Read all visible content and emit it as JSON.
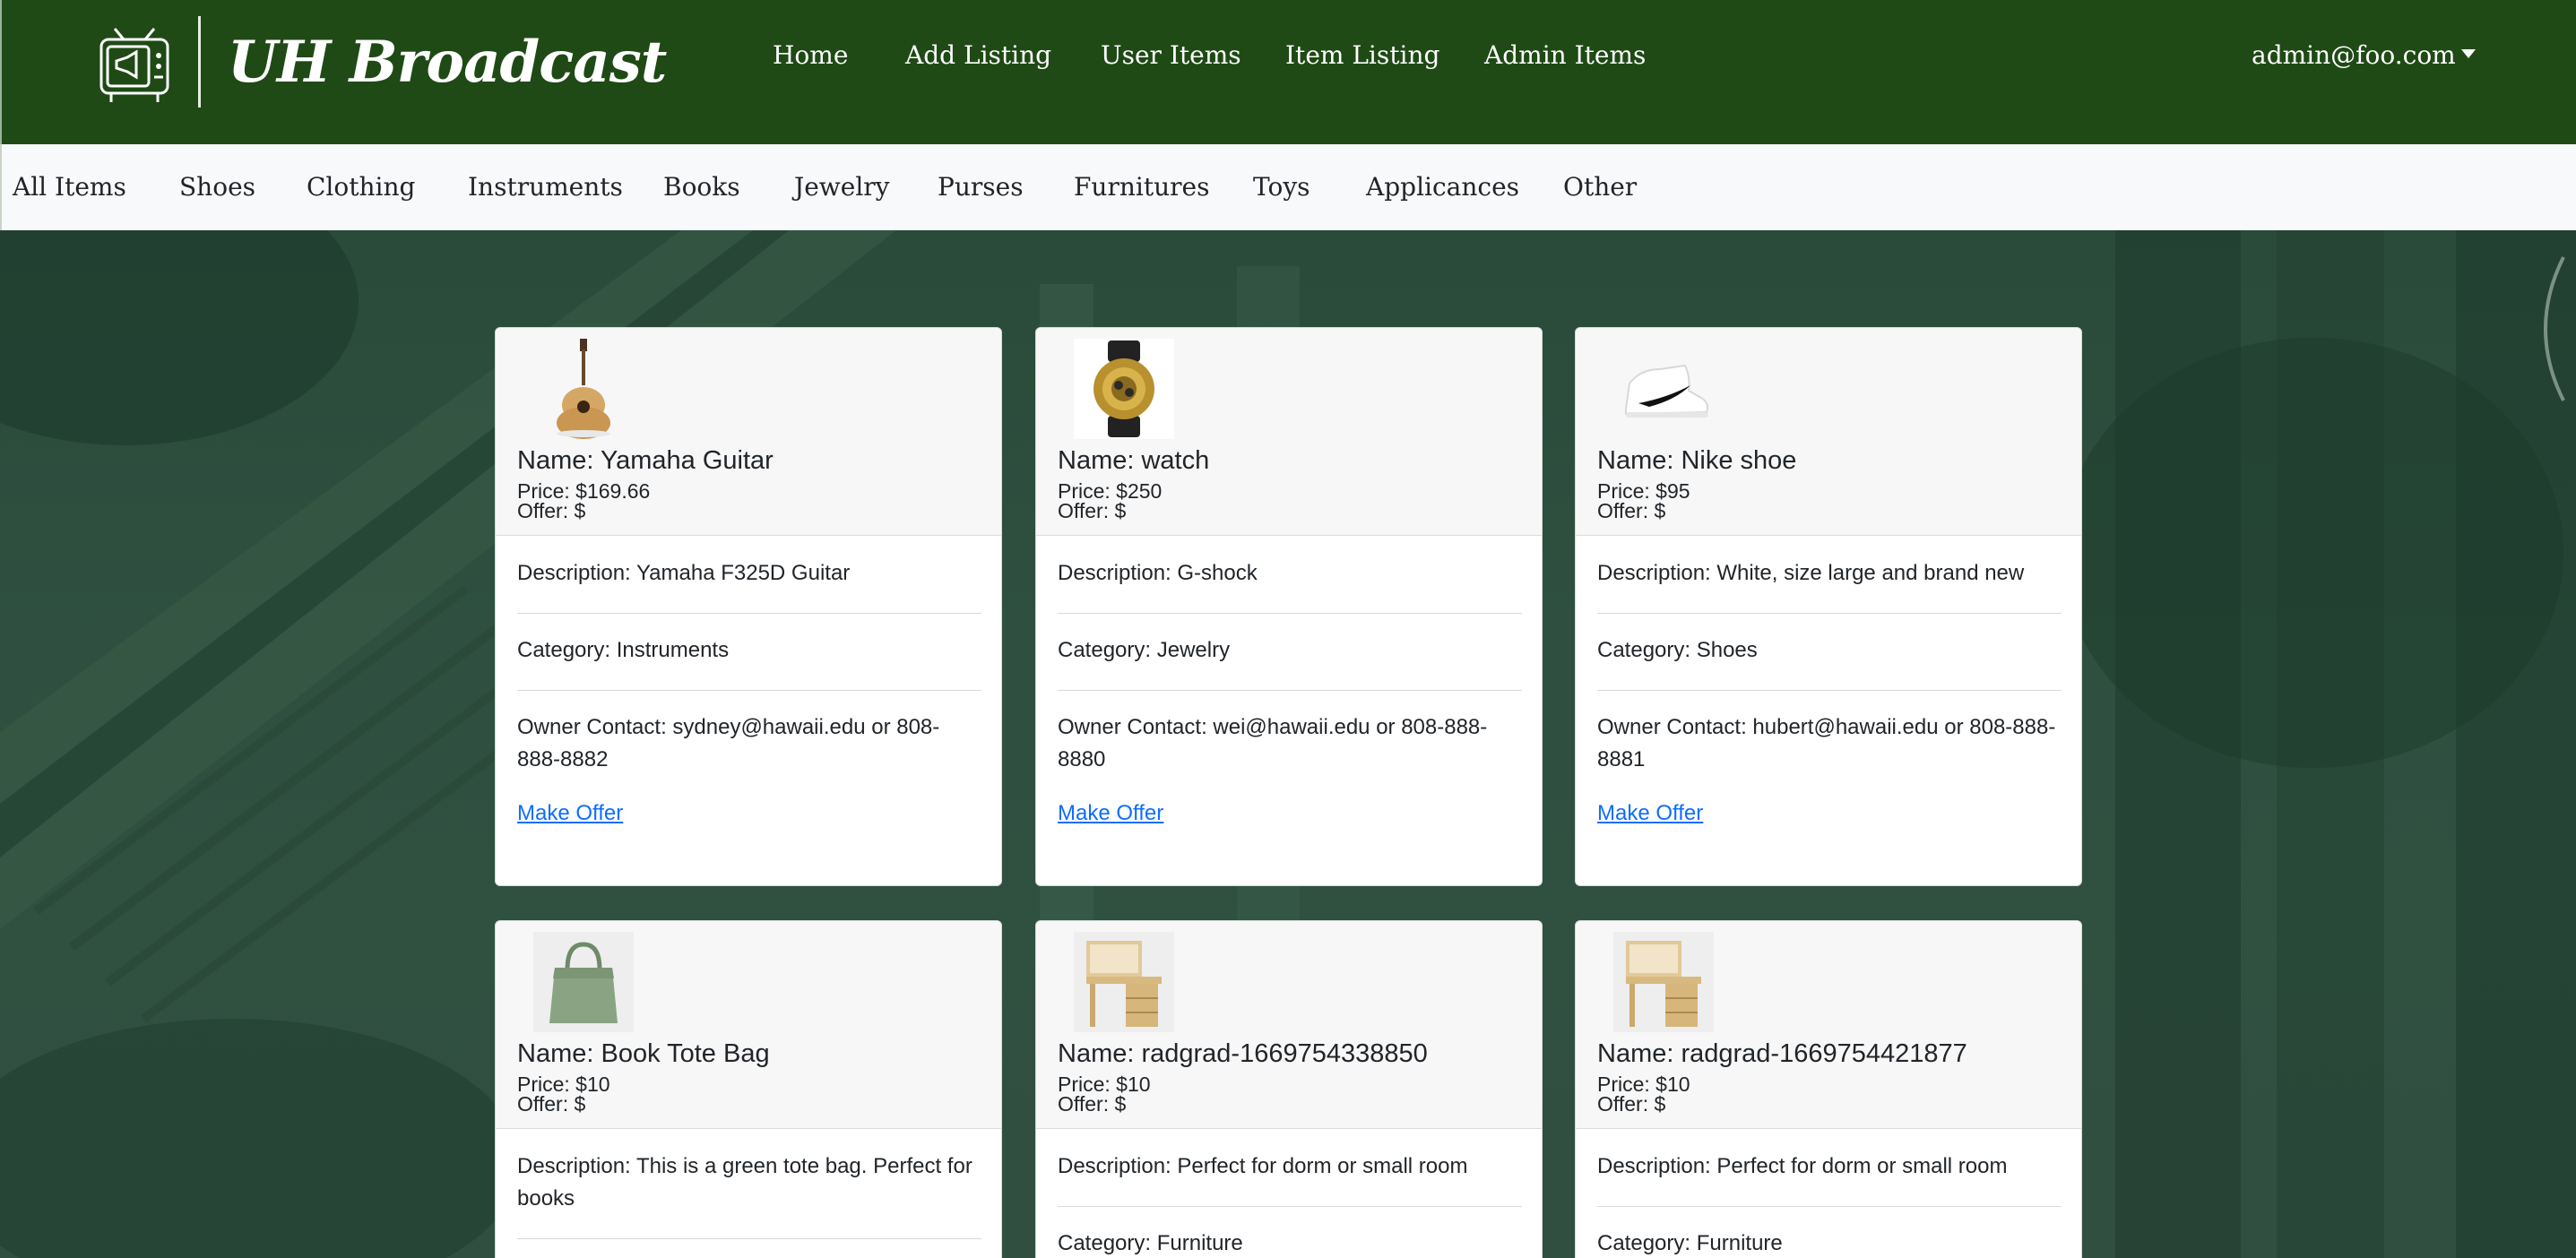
{
  "brand": {
    "title": "UH Broadcast"
  },
  "nav": {
    "links": [
      "Home",
      "Add Listing",
      "User Items",
      "Item Listing",
      "Admin Items"
    ],
    "user": "admin@foo.com"
  },
  "categories": [
    "All Items",
    "Shoes",
    "Clothing",
    "Instruments",
    "Books",
    "Jewelry",
    "Purses",
    "Furnitures",
    "Toys",
    "Applicances",
    "Other"
  ],
  "items": [
    {
      "name": "Name: Yamaha Guitar",
      "price": "Price: $169.66",
      "offer": "Offer: $",
      "description": "Description: Yamaha F325D Guitar",
      "category": "Category: Instruments",
      "contact": "Owner Contact: sydney@hawaii.edu or 808-888-8882",
      "action": "Make Offer",
      "image": "guitar"
    },
    {
      "name": "Name: watch",
      "price": "Price: $250",
      "offer": "Offer: $",
      "description": "Description: G-shock",
      "category": "Category: Jewelry",
      "contact": "Owner Contact: wei@hawaii.edu or 808-888-8880",
      "action": "Make Offer",
      "image": "watch"
    },
    {
      "name": "Name: Nike shoe",
      "price": "Price: $95",
      "offer": "Offer: $",
      "description": "Description: White, size large and brand new",
      "category": "Category: Shoes",
      "contact": "Owner Contact: hubert@hawaii.edu or 808-888-8881",
      "action": "Make Offer",
      "image": "sneaker"
    },
    {
      "name": "Name: Book Tote Bag",
      "price": "Price: $10",
      "offer": "Offer: $",
      "description": "Description: This is a green tote bag. Perfect for books",
      "image": "tote-bag"
    },
    {
      "name": "Name: radgrad-1669754338850",
      "price": "Price: $10",
      "offer": "Offer: $",
      "description": "Description: Perfect for dorm or small room",
      "category": "Category: Furniture",
      "image": "desk"
    },
    {
      "name": "Name: radgrad-1669754421877",
      "price": "Price: $10",
      "offer": "Offer: $",
      "description": "Description: Perfect for dorm or small room",
      "category": "Category: Furniture",
      "image": "desk"
    }
  ]
}
